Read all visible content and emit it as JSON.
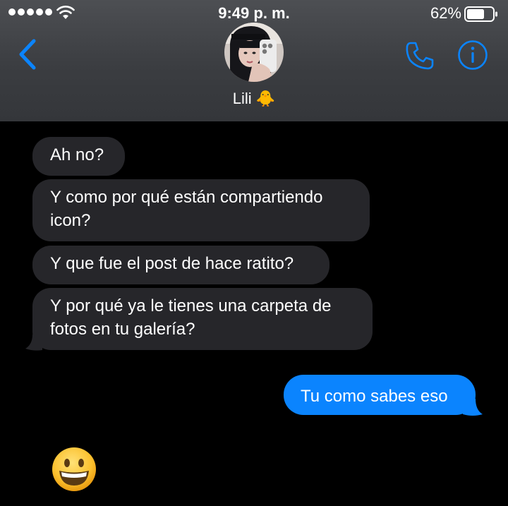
{
  "status_bar": {
    "time": "9:49 p. m.",
    "battery": "62%"
  },
  "header": {
    "contact_name": "Lili 🐥"
  },
  "messages": [
    {
      "direction": "incoming",
      "lines": [
        "Ah no?"
      ]
    },
    {
      "direction": "incoming",
      "lines": [
        "Y como por qué están compartiendo",
        "icon?"
      ]
    },
    {
      "direction": "incoming",
      "lines": [
        "Y que fue el post de hace ratito?"
      ]
    },
    {
      "direction": "incoming",
      "lines": [
        "Y por qué ya le tienes una carpeta de",
        "fotos en tu galería?"
      ]
    },
    {
      "direction": "outgoing",
      "lines": [
        "Tu como sabes eso"
      ]
    }
  ],
  "colors": {
    "accent": "#0b84fe",
    "incoming_bubble": "#26262a",
    "header_bg": "#3b3d41"
  },
  "icons": {
    "back": "chevron-left",
    "call": "phone",
    "info": "info-circle",
    "reaction": "grinning-emoji"
  }
}
